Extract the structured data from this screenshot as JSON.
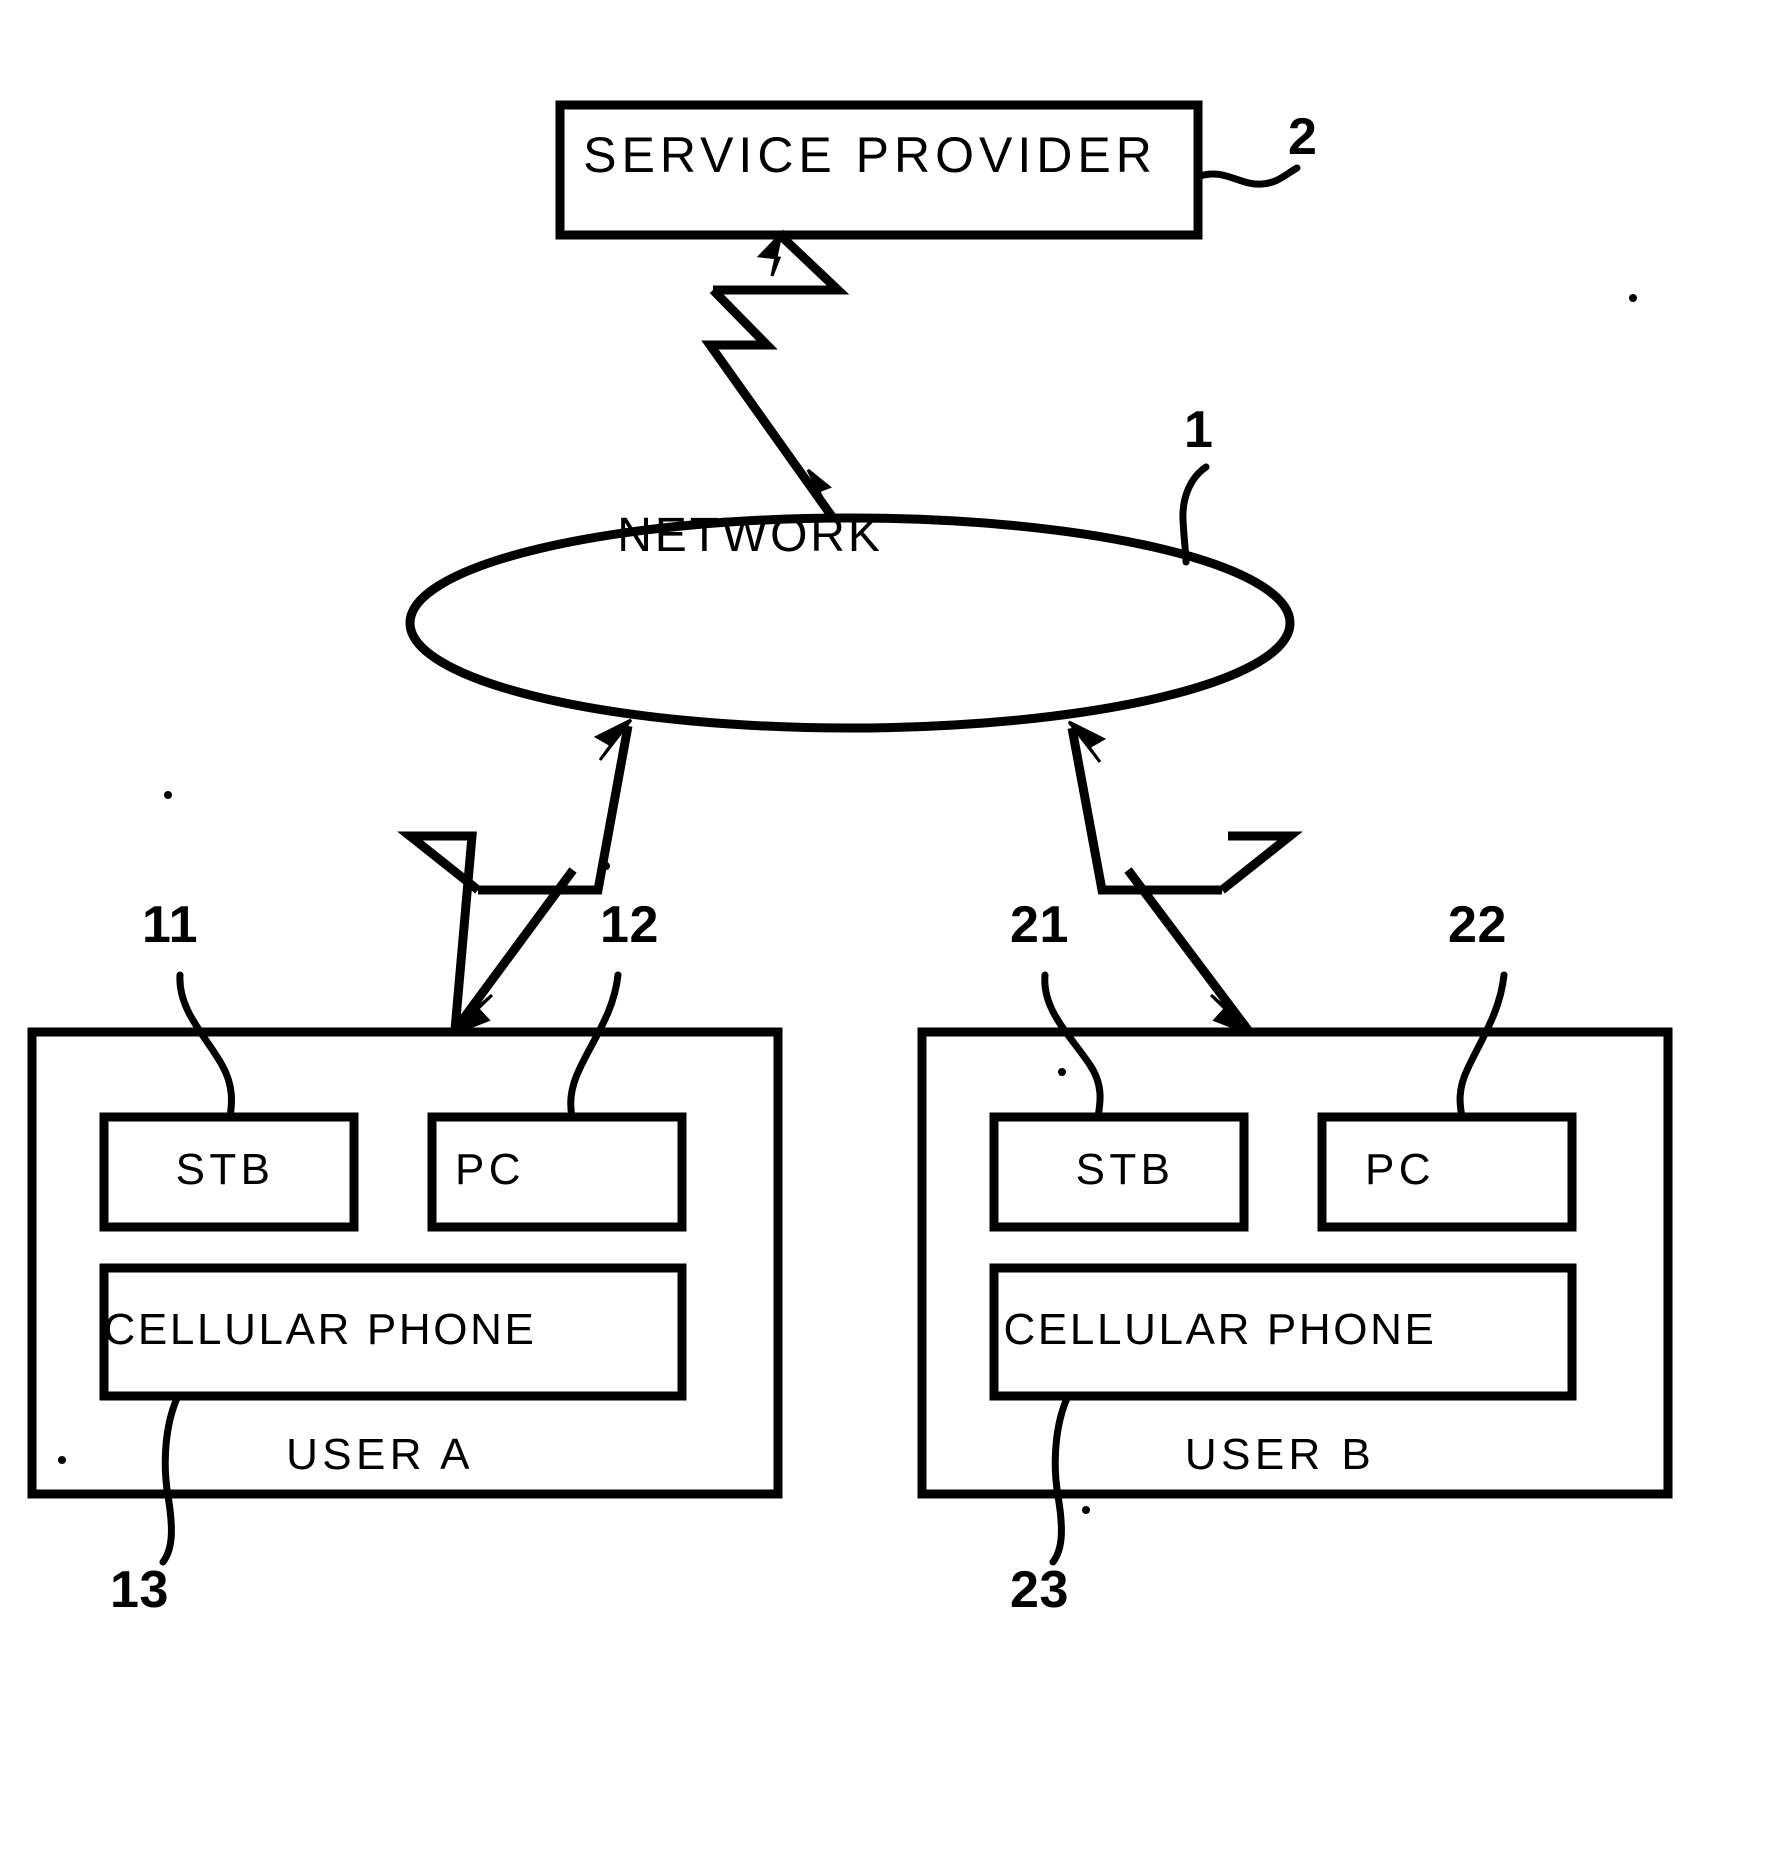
{
  "figure": {
    "type": "network-block-diagram",
    "background_color": "#ffffff",
    "line_color": "#000000",
    "nodes": {
      "service_provider": {
        "label": "SERVICE PROVIDER",
        "ref": "2",
        "shape": "rectangle"
      },
      "network": {
        "label": "NETWORK",
        "ref": "1",
        "shape": "ellipse"
      },
      "user_a": {
        "label": "USER A",
        "shape": "rectangle",
        "devices": [
          {
            "label": "STB",
            "ref": "11"
          },
          {
            "label": "PC",
            "ref": "12"
          },
          {
            "label": "CELLULAR PHONE",
            "ref": "13"
          }
        ]
      },
      "user_b": {
        "label": "USER B",
        "shape": "rectangle",
        "devices": [
          {
            "label": "STB",
            "ref": "21"
          },
          {
            "label": "PC",
            "ref": "22"
          },
          {
            "label": "CELLULAR PHONE",
            "ref": "23"
          }
        ]
      }
    },
    "reference_numerals": {
      "service_provider": "2",
      "network": "1",
      "user_a_stb": "11",
      "user_a_pc": "12",
      "user_a_cellular_phone": "13",
      "user_b_stb": "21",
      "user_b_pc": "22",
      "user_b_cellular_phone": "23"
    },
    "connections": [
      {
        "from": "network",
        "to": "service_provider",
        "style": "lightning-bolt",
        "arrows": "both"
      },
      {
        "from": "network",
        "to": "user_a",
        "style": "lightning-bolt",
        "arrows": "both"
      },
      {
        "from": "network",
        "to": "user_b",
        "style": "lightning-bolt",
        "arrows": "both"
      }
    ]
  }
}
